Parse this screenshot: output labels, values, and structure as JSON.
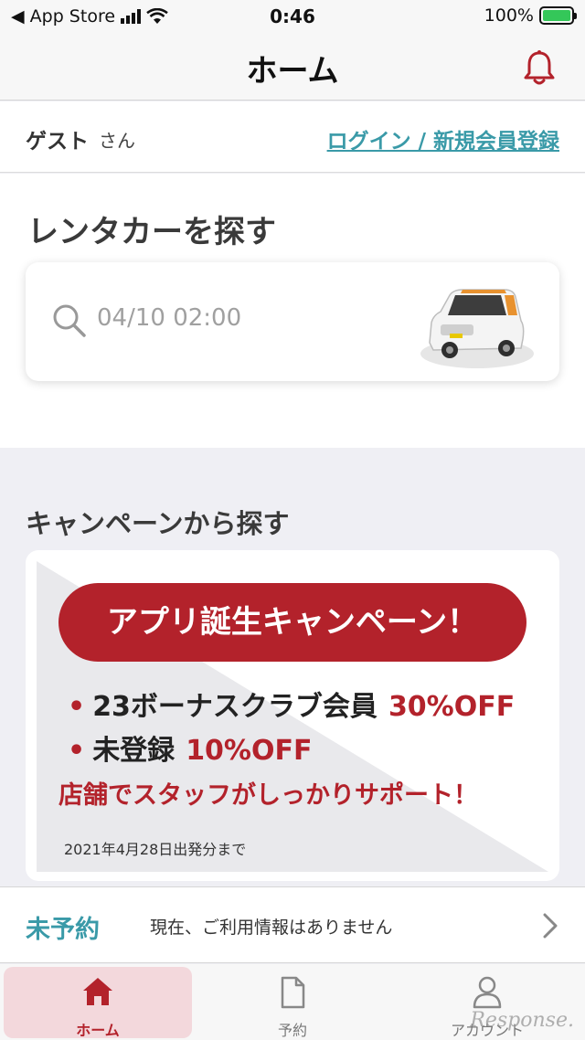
{
  "status_bar": {
    "back_label": "◀ App Store",
    "time": "0:46",
    "battery_percent": "100%"
  },
  "nav": {
    "title": "ホーム",
    "bell_icon": "bell-icon"
  },
  "guest": {
    "name": "ゲスト",
    "suffix": "さん",
    "login_link": "ログイン / 新規会員登録"
  },
  "search": {
    "title": "レンタカーを探す",
    "date_placeholder": "04/10 02:00",
    "icon": "search-icon"
  },
  "campaign": {
    "title": "キャンペーンから探す",
    "banner": {
      "headline": "アプリ誕生キャンペーン！",
      "bullet1_text": "23ボーナスクラブ会員",
      "bullet1_discount": "30%OFF",
      "bullet2_text": "未登録",
      "bullet2_discount": "10%OFF",
      "support": "店舗でスタッフがしっかりサポート！",
      "deadline": "2021年4月28日出発分まで"
    }
  },
  "reservation": {
    "status": "未予約",
    "message": "現在、ご利用情報はありません"
  },
  "tabs": [
    {
      "label": "ホーム",
      "icon": "home-icon",
      "active": true
    },
    {
      "label": "予約",
      "icon": "document-icon",
      "active": false
    },
    {
      "label": "アカウント",
      "icon": "user-icon",
      "active": false
    }
  ],
  "watermark": "Response.",
  "colors": {
    "accent_red": "#b3222b",
    "accent_teal": "#3a9aa8",
    "background": "#efeff4"
  }
}
